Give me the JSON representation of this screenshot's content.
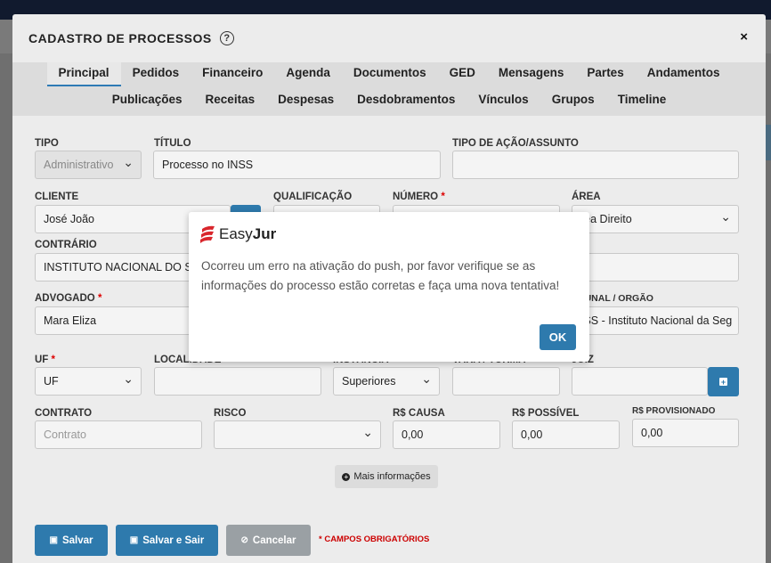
{
  "modal": {
    "title": "CADASTRO DE PROCESSOS",
    "help_symbol": "?",
    "close_symbol": "×"
  },
  "tabs": {
    "row1": [
      "Principal",
      "Pedidos",
      "Financeiro",
      "Agenda",
      "Documentos",
      "GED",
      "Mensagens",
      "Partes",
      "Andamentos"
    ],
    "row2": [
      "Publicações",
      "Receitas",
      "Despesas",
      "Desdobramentos",
      "Vínculos",
      "Grupos",
      "Timeline"
    ],
    "active": "Principal"
  },
  "fields": {
    "tipo": {
      "label": "TIPO",
      "value": "Administrativo"
    },
    "titulo": {
      "label": "TÍTULO",
      "value": "Processo no INSS"
    },
    "tipo_acao": {
      "label": "TIPO DE AÇÃO/ASSUNTO",
      "value": ""
    },
    "cliente": {
      "label": "CLIENTE",
      "value": "José João"
    },
    "qualificacao": {
      "label": "QUALIFICAÇÃO",
      "value": ""
    },
    "numero": {
      "label": "NÚMERO",
      "required": "*",
      "value": ""
    },
    "area": {
      "label": "ÁREA",
      "value": "rea Direito"
    },
    "contrario": {
      "label": "CONTRÁRIO",
      "value": "INSTITUTO NACIONAL DO SE"
    },
    "advogado": {
      "label": "ADVOGADO",
      "required": "*",
      "value": "Mara Eliza"
    },
    "tribunal": {
      "label": "BUNAL / ORGÃO",
      "value": "ISS - Instituto Nacional da Seg"
    },
    "uf": {
      "label": "UF",
      "required": "*",
      "value": "UF"
    },
    "localidade": {
      "label": "LOCALIDADE",
      "value": ""
    },
    "instancia": {
      "label": "INSTÂNCIA",
      "value": "Superiores"
    },
    "vara": {
      "label": "VARA / TURMA",
      "value": ""
    },
    "juiz": {
      "label": "JUIZ",
      "value": ""
    },
    "contrato": {
      "label": "CONTRATO",
      "placeholder": "Contrato"
    },
    "risco": {
      "label": "RISCO",
      "value": ""
    },
    "rs_causa": {
      "label": "R$ CAUSA",
      "value": "0,00"
    },
    "rs_possivel": {
      "label": "R$ POSSÍVEL",
      "value": "0,00"
    },
    "rs_provisionado": {
      "label": "R$ PROVISIONADO",
      "value": "0,00"
    }
  },
  "buttons": {
    "mais_info": "Mais informações",
    "salvar": "Salvar",
    "salvar_sair": "Salvar e Sair",
    "cancelar": "Cancelar",
    "campos_obrigatorios": "* CAMPOS OBRIGATÓRIOS"
  },
  "dialog": {
    "logo_prefix": "Easy",
    "logo_bold": "Jur",
    "message": "Ocorreu um erro na ativação do push, por favor verifique se as informações do processo estão corretas e faça uma nova tentativa!",
    "ok": "OK"
  },
  "colors": {
    "primary": "#2e7aad",
    "logo_red": "#d9262c",
    "required": "#cc0000"
  }
}
